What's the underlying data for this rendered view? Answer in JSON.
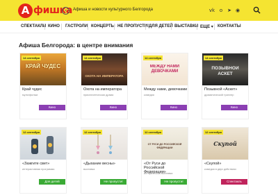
{
  "header": {
    "logo_letter": "А",
    "logo_text": "фишка",
    "back_glyph": "‹",
    "tagline": "Афиша и новости культурного Белгорода",
    "social": [
      {
        "icon": "vk-icon",
        "glyph": "vk"
      },
      {
        "icon": "ok-icon",
        "glyph": "o"
      },
      {
        "icon": "telegram-icon",
        "glyph": "➤"
      },
      {
        "icon": "viber-icon",
        "glyph": "◉"
      }
    ],
    "search_icon": "search-icon"
  },
  "nav": {
    "items": [
      "СПЕКТАКЛИ",
      "КИНО",
      "ГАСТРОЛИ",
      "КОНЦЕРТЫ",
      "НЕ ПРОПУСТИ!",
      "ДЛЯ ДЕТЕЙ",
      "ВЫСТАВКИ",
      "ЕЩЕ",
      "КОНТАКТЫ"
    ],
    "more_chevron": "▾"
  },
  "section": {
    "title": "Афиша Белгорода: в центре внимания"
  },
  "colors": {
    "brand_yellow": "#f5e431",
    "brand_red": "#e3241b",
    "btn_kino": "#8b3fb3",
    "btn_children": "#3aaa35",
    "btn_not_miss": "#3aaa35",
    "btn_spectacle": "#c0245c"
  },
  "cards": [
    {
      "date": "14 сентября",
      "age": "",
      "poster": "КРАЙ ЧУДЕС",
      "title": "Край чудес",
      "genre": "мультфильм",
      "price": "",
      "button": "Кино",
      "button_color": "#8b3fb3"
    },
    {
      "date": "14 сентября",
      "age": "",
      "poster": "ОХОТА НА ИМПЕРАТОРА",
      "title": "Охота на императора",
      "genre": "приключенческая драма",
      "price": "",
      "button": "Кино",
      "button_color": "#8b3fb3"
    },
    {
      "date": "14 сентября",
      "age": "",
      "poster": "МЕЖДУ НАМИ ДЕВОЧКАМИ",
      "title": "Между нами, девочками",
      "genre": "комедия",
      "price": "",
      "button": "Кино",
      "button_color": "#8b3fb3"
    },
    {
      "date": "14 сентября",
      "age": "",
      "poster": "ПОЗЫВНОЙ АСКЕТ",
      "title": "Позывной «Аскет»",
      "genre": "драматический триллер",
      "price": "",
      "button": "Кино",
      "button_color": "#8b3fb3"
    },
    {
      "date": "12 сентября",
      "age": "",
      "poster": "",
      "title": "«Зажгите свет»",
      "genre": "интерактивная программа",
      "price": "",
      "button": "Для детей",
      "button_color": "#3aaa35"
    },
    {
      "date": "12 сентября",
      "age": "",
      "poster": "",
      "title": "«Дыхание весны»",
      "genre": "выставка",
      "price": "",
      "button": "Не пропусти!",
      "button_color": "#3aaa35"
    },
    {
      "date": "12 сентября",
      "age": "",
      "poster": "ОТ РУСИ ДО РОССИЙСКОЙ ФЕДЕРАЦИИ",
      "title": "«От Руси до Российской Федерации»",
      "genre": "историческая выставка",
      "price": "",
      "button": "Не пропусти!",
      "button_color": "#3aaa35"
    },
    {
      "date": "12 сентября",
      "age": "",
      "poster": "Скупой",
      "title": "«Скупой»",
      "genre": "комедия в двух действиях",
      "price": "",
      "button": "Спектакль",
      "button_color": "#c0245c"
    }
  ]
}
